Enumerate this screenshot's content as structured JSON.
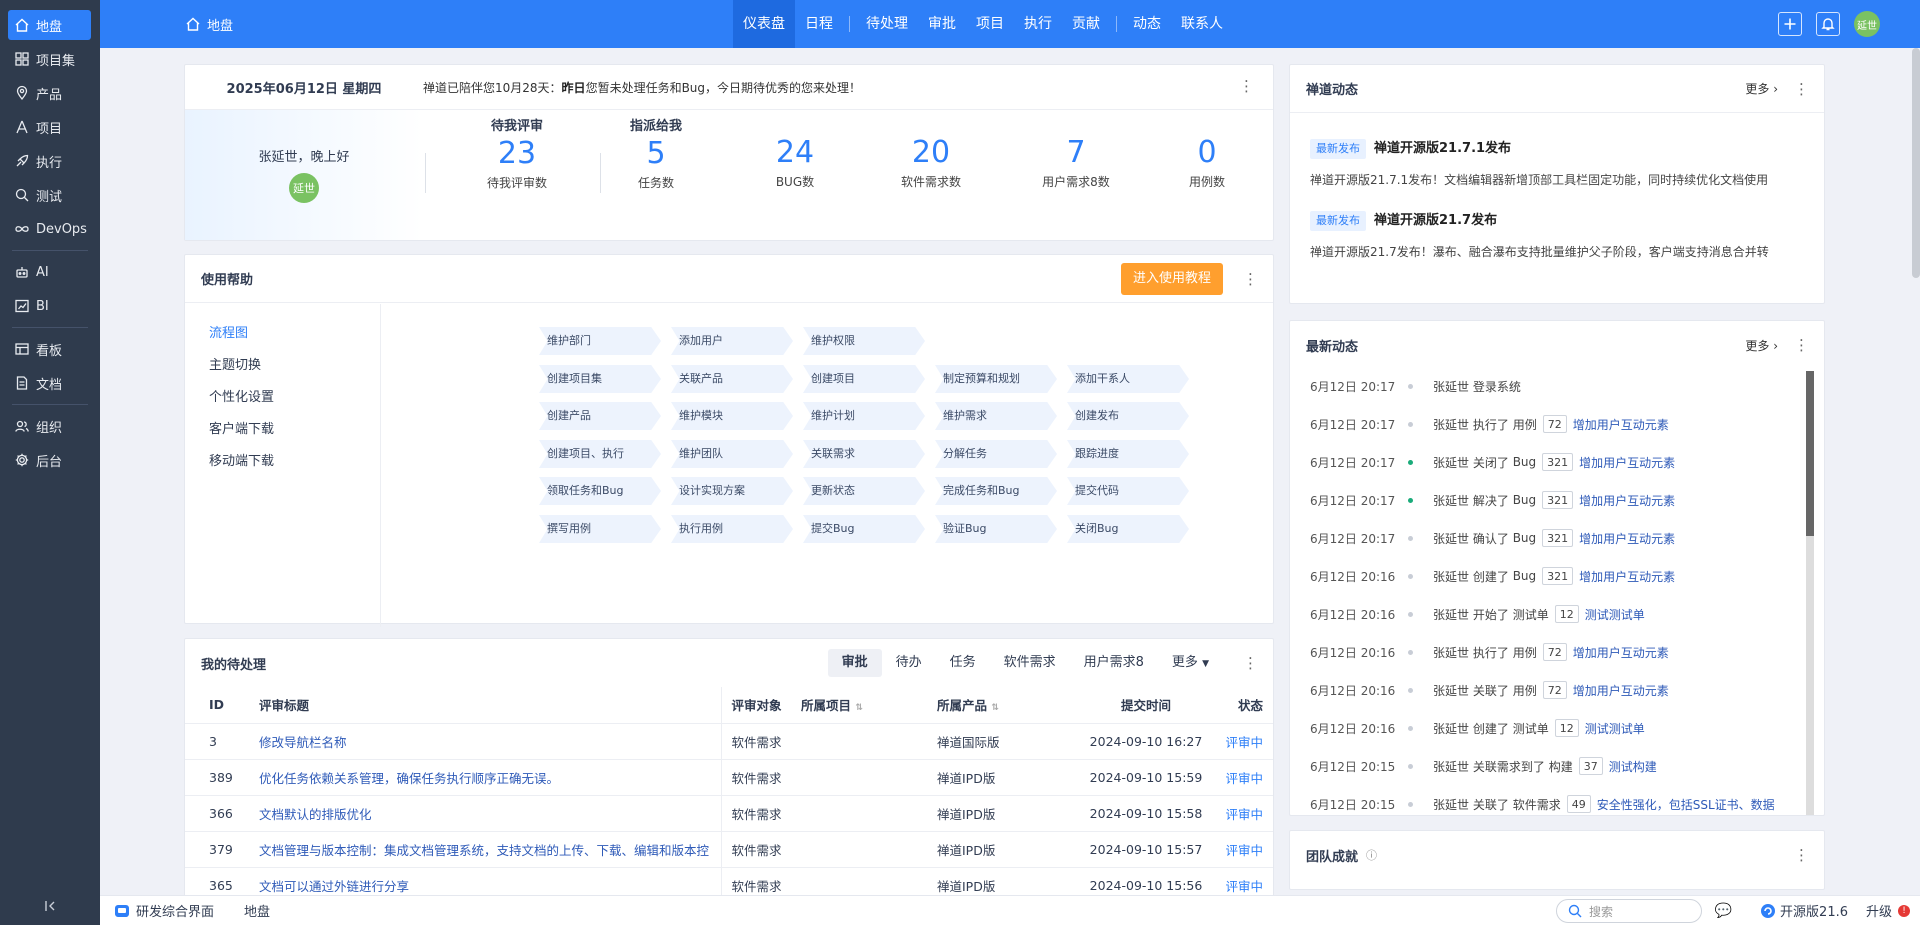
{
  "sidebar": {
    "items": [
      {
        "label": "地盘",
        "icon": "home-icon"
      },
      {
        "label": "项目集",
        "icon": "grid-icon"
      },
      {
        "label": "产品",
        "icon": "location-icon"
      },
      {
        "label": "项目",
        "icon": "project-icon"
      },
      {
        "label": "执行",
        "icon": "rocket-icon"
      },
      {
        "label": "测试",
        "icon": "search-icon"
      },
      {
        "label": "DevOps",
        "icon": "infinity-icon"
      },
      {
        "label": "AI",
        "icon": "robot-icon"
      },
      {
        "label": "BI",
        "icon": "chart-icon"
      },
      {
        "label": "看板",
        "icon": "kanban-icon"
      },
      {
        "label": "文档",
        "icon": "document-icon"
      },
      {
        "label": "组织",
        "icon": "people-icon"
      },
      {
        "label": "后台",
        "icon": "gear-icon"
      }
    ]
  },
  "header": {
    "home": "地盘",
    "tabs": [
      "仪表盘",
      "日程",
      "待处理",
      "审批",
      "项目",
      "执行",
      "贡献",
      "动态",
      "联系人"
    ],
    "avatar": "延世"
  },
  "welcome": {
    "date": "2025年06月12日 星期四",
    "notice_prefix": "禅道已陪伴您10月28天：",
    "notice_bold": "昨日",
    "notice_suffix": "您暂未处理任务和Bug，今日期待优秀的您来处理！",
    "greeting": "张延世，晚上好",
    "avatar": "延世",
    "review_title": "待我评审",
    "assigned_title": "指派给我",
    "stats": [
      {
        "num": "23",
        "label": "待我评审数"
      },
      {
        "num": "5",
        "label": "任务数"
      },
      {
        "num": "24",
        "label": "BUG数"
      },
      {
        "num": "20",
        "label": "软件需求数"
      },
      {
        "num": "7",
        "label": "用户需求8数"
      },
      {
        "num": "0",
        "label": "用例数"
      }
    ]
  },
  "help": {
    "title": "使用帮助",
    "button": "进入使用教程",
    "side": [
      "流程图",
      "主题切换",
      "个性化设置",
      "客户端下载",
      "移动端下载"
    ],
    "flow": [
      [
        "维护部门",
        "添加用户",
        "维护权限"
      ],
      [
        "创建项目集",
        "关联产品",
        "创建项目",
        "制定预算和规划",
        "添加干系人"
      ],
      [
        "创建产品",
        "维护模块",
        "维护计划",
        "维护需求",
        "创建发布"
      ],
      [
        "创建项目、执行",
        "维护团队",
        "关联需求",
        "分解任务",
        "跟踪进度"
      ],
      [
        "领取任务和Bug",
        "设计实现方案",
        "更新状态",
        "完成任务和Bug",
        "提交代码"
      ],
      [
        "撰写用例",
        "执行用例",
        "提交Bug",
        "验证Bug",
        "关闭Bug"
      ]
    ]
  },
  "todo": {
    "title": "我的待处理",
    "tabs": [
      "审批",
      "待办",
      "任务",
      "软件需求",
      "用户需求8",
      "更多"
    ],
    "columns": [
      "ID",
      "评审标题",
      "评审对象",
      "所属项目",
      "所属产品",
      "提交时间",
      "状态"
    ],
    "rows": [
      [
        "3",
        "修改导航栏名称",
        "软件需求",
        "",
        "禅道国际版",
        "2024-09-10 16:27",
        "评审中"
      ],
      [
        "389",
        "优化任务依赖关系管理，确保任务执行顺序正确无误。",
        "软件需求",
        "",
        "禅道IPD版",
        "2024-09-10 15:59",
        "评审中"
      ],
      [
        "366",
        "文档默认的排版优化",
        "软件需求",
        "",
        "禅道IPD版",
        "2024-09-10 15:58",
        "评审中"
      ],
      [
        "379",
        "文档管理与版本控制：集成文档管理系统，支持文档的上传、下载、编辑和版本控",
        "软件需求",
        "",
        "禅道IPD版",
        "2024-09-10 15:57",
        "评审中"
      ],
      [
        "365",
        "文档可以通过外链进行分享",
        "软件需求",
        "",
        "禅道IPD版",
        "2024-09-10 15:56",
        "评审中"
      ]
    ]
  },
  "news": {
    "title": "禅道动态",
    "more": "更多",
    "items": [
      {
        "badge": "最新发布",
        "title": "禅道开源版21.7.1发布",
        "desc": "禅道开源版21.7.1发布！文档编辑器新增顶部工具栏固定功能，同时持续优化文档使用"
      },
      {
        "badge": "最新发布",
        "title": "禅道开源版21.7发布",
        "desc": "禅道开源版21.7发布！瀑布、融合瀑布支持批量维护父子阶段，客户端支持消息合并转"
      }
    ]
  },
  "activity": {
    "title": "最新动态",
    "more": "更多",
    "items": [
      {
        "time": "6月12日 20:17",
        "user": "张延世",
        "action": "登录系统",
        "type": "",
        "id": "",
        "link": "",
        "green": false
      },
      {
        "time": "6月12日 20:17",
        "user": "张延世",
        "action": "执行了",
        "type": "用例",
        "id": "72",
        "link": "增加用户互动元素",
        "green": false
      },
      {
        "time": "6月12日 20:17",
        "user": "张延世",
        "action": "关闭了",
        "type": "Bug",
        "id": "321",
        "link": "增加用户互动元素",
        "green": true
      },
      {
        "time": "6月12日 20:17",
        "user": "张延世",
        "action": "解决了",
        "type": "Bug",
        "id": "321",
        "link": "增加用户互动元素",
        "green": true
      },
      {
        "time": "6月12日 20:17",
        "user": "张延世",
        "action": "确认了",
        "type": "Bug",
        "id": "321",
        "link": "增加用户互动元素",
        "green": false
      },
      {
        "time": "6月12日 20:16",
        "user": "张延世",
        "action": "创建了",
        "type": "Bug",
        "id": "321",
        "link": "增加用户互动元素",
        "green": false
      },
      {
        "time": "6月12日 20:16",
        "user": "张延世",
        "action": "开始了",
        "type": "测试单",
        "id": "12",
        "link": "测试测试单",
        "green": false
      },
      {
        "time": "6月12日 20:16",
        "user": "张延世",
        "action": "执行了",
        "type": "用例",
        "id": "72",
        "link": "增加用户互动元素",
        "green": false
      },
      {
        "time": "6月12日 20:16",
        "user": "张延世",
        "action": "关联了",
        "type": "用例",
        "id": "72",
        "link": "增加用户互动元素",
        "green": false
      },
      {
        "time": "6月12日 20:16",
        "user": "张延世",
        "action": "创建了",
        "type": "测试单",
        "id": "12",
        "link": "测试测试单",
        "green": false
      },
      {
        "time": "6月12日 20:15",
        "user": "张延世",
        "action": "关联需求到了",
        "type": "构建",
        "id": "37",
        "link": "测试构建",
        "green": false
      },
      {
        "time": "6月12日 20:15",
        "user": "张延世",
        "action": "关联了",
        "type": "软件需求",
        "id": "49",
        "link": "安全性强化，包括SSL证书、数据",
        "green": false
      }
    ]
  },
  "team": {
    "title": "团队成就"
  },
  "footer": {
    "app": "研发综合界面",
    "crumb": "地盘",
    "search_placeholder": "搜索",
    "version": "开源版21.6",
    "upgrade": "升级"
  }
}
